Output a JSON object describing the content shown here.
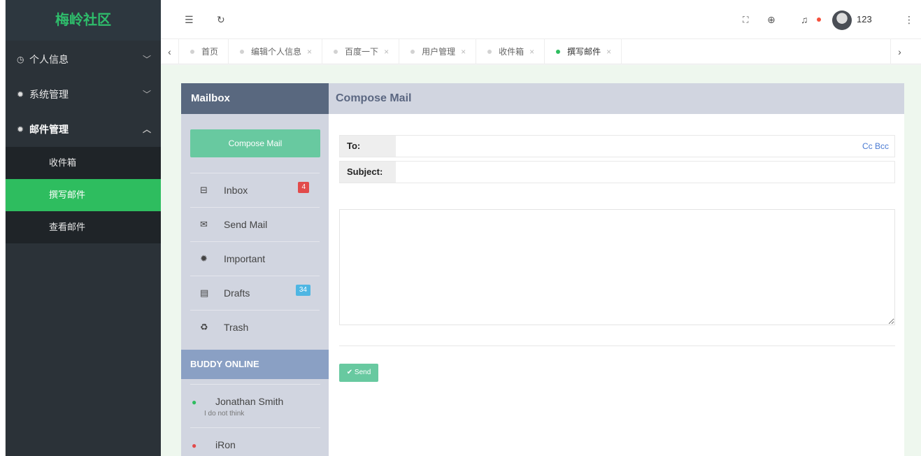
{
  "sidebar": {
    "logo": "梅岭社区",
    "groups": [
      {
        "label": "个人信息",
        "icon": "gauge-icon",
        "open": false
      },
      {
        "label": "系统管理",
        "icon": "gear-icon",
        "open": false
      },
      {
        "label": "邮件管理",
        "icon": "gear-icon",
        "open": true
      }
    ],
    "submenu": [
      {
        "label": "收件箱",
        "active": false
      },
      {
        "label": "撰写邮件",
        "active": true
      },
      {
        "label": "查看邮件",
        "active": false
      }
    ]
  },
  "header": {
    "username": "123",
    "icons": [
      "menu-fold-icon",
      "refresh-icon",
      "fullscreen-icon",
      "globe-icon",
      "bell-icon",
      "more-icon"
    ]
  },
  "tabs": [
    {
      "label": "首页",
      "closable": false,
      "active": false
    },
    {
      "label": "编辑个人信息",
      "closable": true,
      "active": false
    },
    {
      "label": "百度一下",
      "closable": true,
      "active": false
    },
    {
      "label": "用户管理",
      "closable": true,
      "active": false
    },
    {
      "label": "收件箱",
      "closable": true,
      "active": false
    },
    {
      "label": "撰写邮件",
      "closable": true,
      "active": true
    }
  ],
  "mailbox": {
    "title": "Mailbox",
    "compose_label": "Compose Mail",
    "folders": [
      {
        "label": "Inbox",
        "icon": "inbox-icon",
        "badge": "4"
      },
      {
        "label": "Send Mail",
        "icon": "envelope-icon",
        "badge": ""
      },
      {
        "label": "Important",
        "icon": "star-icon",
        "badge": ""
      },
      {
        "label": "Drafts",
        "icon": "document-icon",
        "badge": "34"
      },
      {
        "label": "Trash",
        "icon": "trash-icon",
        "badge": ""
      }
    ],
    "buddy_title": "BUDDY ONLINE",
    "buddies": [
      {
        "name": "Jonathan Smith",
        "message": "I do not think",
        "color": "#2ebd5f"
      },
      {
        "name": "iRon",
        "message": "",
        "color": "#e24b4b"
      }
    ]
  },
  "compose": {
    "title": "Compose Mail",
    "to_label": "To:",
    "to_value": "",
    "cc_bcc": "Cc Bcc",
    "subject_label": "Subject:",
    "subject_value": "",
    "body_value": "",
    "send_label": "Send"
  },
  "colors": {
    "accent": "#2ebd5f",
    "sidebar_bg": "#2b3238",
    "mailbox_header": "#59687f",
    "compose_button": "#68c9a0",
    "buddy_header": "#8aa0c4"
  }
}
